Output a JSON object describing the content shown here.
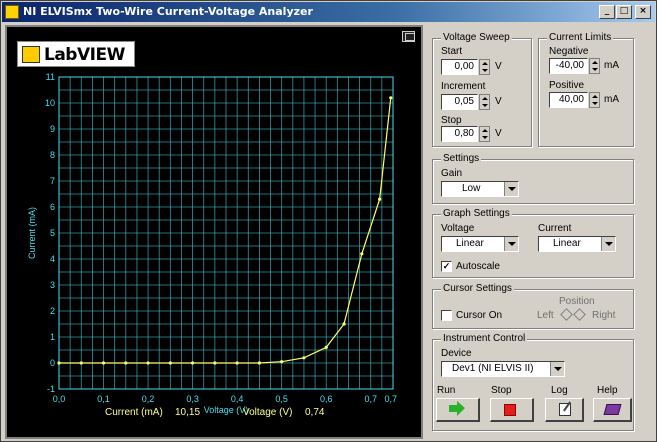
{
  "window": {
    "title": "NI ELVISmx Two-Wire Current-Voltage Analyzer",
    "controls": {
      "minimize": "_",
      "maximize": "□",
      "close": "×"
    }
  },
  "logo": {
    "text": "LabVIEW"
  },
  "graph": {
    "readout_current_label": "Current (mA)",
    "readout_current_value": "10,15",
    "readout_voltage_label": "Voltage (V)",
    "readout_voltage_value": "0,74"
  },
  "chart_data": {
    "type": "line",
    "xlabel": "Voltage (V)",
    "ylabel": "Current (mA)",
    "xlim": [
      0,
      0.75
    ],
    "ylim": [
      -1,
      11
    ],
    "grid": true,
    "x_tick_labels": [
      "0,0",
      "0,1",
      "0,2",
      "0,3",
      "0,4",
      "0,5",
      "0,6",
      "0,7",
      "0,7"
    ],
    "x_tick_values": [
      0,
      0.1,
      0.2,
      0.3,
      0.4,
      0.5,
      0.6,
      0.7,
      0.745
    ],
    "y_ticks": [
      -1,
      0,
      1,
      2,
      3,
      4,
      5,
      6,
      7,
      8,
      9,
      10,
      11
    ],
    "line_color": "#ffff66",
    "grid_color": "#40c8d8",
    "axis_color": "#40e0f0",
    "series": [
      {
        "x": [
          0.0,
          0.05,
          0.1,
          0.15,
          0.2,
          0.25,
          0.3,
          0.35,
          0.4,
          0.45,
          0.5,
          0.55,
          0.6,
          0.64,
          0.68,
          0.72,
          0.745
        ],
        "y": [
          0.0,
          0.0,
          0.0,
          0.0,
          0.0,
          0.0,
          0.0,
          0.0,
          0.0,
          0.0,
          0.05,
          0.2,
          0.6,
          1.5,
          4.2,
          6.3,
          10.2
        ]
      }
    ]
  },
  "voltage_sweep": {
    "title": "Voltage Sweep",
    "start_label": "Start",
    "start_value": "0,00",
    "start_unit": "V",
    "increment_label": "Increment",
    "increment_value": "0,05",
    "increment_unit": "V",
    "stop_label": "Stop",
    "stop_value": "0,80",
    "stop_unit": "V"
  },
  "current_limits": {
    "title": "Current Limits",
    "negative_label": "Negative",
    "negative_value": "-40,00",
    "negative_unit": "mA",
    "positive_label": "Positive",
    "positive_value": "40,00",
    "positive_unit": "mA"
  },
  "settings": {
    "title": "Settings",
    "gain_label": "Gain",
    "gain_value": "Low"
  },
  "graph_settings": {
    "title": "Graph Settings",
    "voltage_label": "Voltage",
    "voltage_value": "Linear",
    "current_label": "Current",
    "current_value": "Linear",
    "autoscale_label": "Autoscale",
    "autoscale_checked": "✓"
  },
  "cursor_settings": {
    "title": "Cursor Settings",
    "cursor_on_label": "Cursor On",
    "position_label": "Position",
    "left_label": "Left",
    "right_label": "Right"
  },
  "instrument_control": {
    "title": "Instrument Control",
    "device_label": "Device",
    "device_value": "Dev1 (NI ELVIS II)",
    "run_label": "Run",
    "stop_label": "Stop",
    "log_label": "Log",
    "help_label": "Help"
  }
}
